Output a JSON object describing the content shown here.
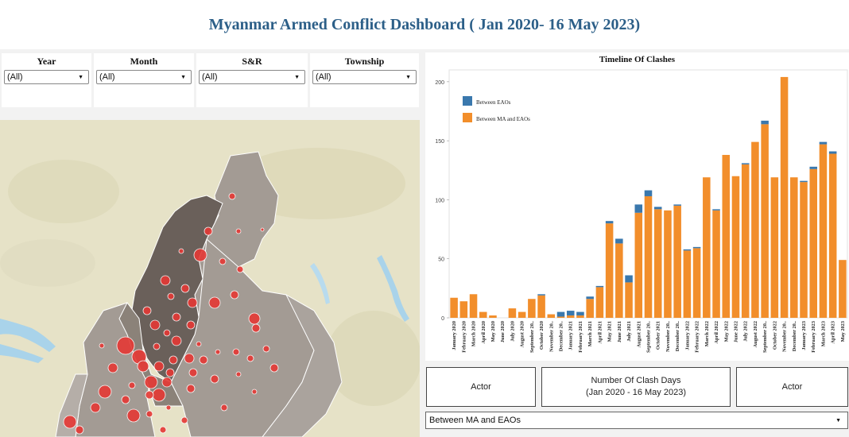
{
  "page_title": "Myanmar Armed Conflict Dashboard ( Jan 2020- 16 May 2023)",
  "filters": [
    {
      "label": "Year",
      "value": "(All)"
    },
    {
      "label": "Month",
      "value": "(All)"
    },
    {
      "label": "S&R",
      "value": "(All)"
    },
    {
      "label": "Township",
      "value": "(All)"
    }
  ],
  "timeline": {
    "title": "Timeline Of Clashes",
    "colors": {
      "Between EAOs": "#3a78ad",
      "Between MA and EAOs": "#f28e2b"
    }
  },
  "kpi": {
    "actor_left": "Actor",
    "clash_days_line1": "Number Of Clash Days",
    "clash_days_line2": "(Jan 2020 - 16 May 2023)",
    "actor_right": "Actor"
  },
  "actor_select": {
    "value": "Between MA and EAOs"
  },
  "chart_data": {
    "type": "bar",
    "stacked": true,
    "title": "Timeline Of Clashes",
    "ylim": [
      0,
      210
    ],
    "yticks": [
      0,
      50,
      100,
      150,
      200
    ],
    "legend_position": "top-left",
    "categories": [
      "January 2020",
      "February 2020",
      "March 2020",
      "April 2020",
      "May 2020",
      "June 2020",
      "July 2020",
      "August 2020",
      "September 20..",
      "October 2020",
      "November 20..",
      "December 20..",
      "January 2021",
      "February 2021",
      "March 2021",
      "April 2021",
      "May 2021",
      "June 2021",
      "July 2021",
      "August 2021",
      "September 20..",
      "October 2021",
      "November 20..",
      "December 20..",
      "January 2022",
      "February 2022",
      "March 2022",
      "April 2022",
      "May 2022",
      "June 2022",
      "July 2022",
      "August 2022",
      "September 20..",
      "October 2022",
      "November 20..",
      "December 20..",
      "January 2023",
      "February 2023",
      "March 2023",
      "April 2023",
      "May 2023"
    ],
    "series": [
      {
        "name": "Between EAOs",
        "values": [
          0,
          0,
          0,
          0,
          0,
          0,
          0,
          0,
          0,
          1,
          0,
          4,
          4,
          3,
          2,
          1,
          2,
          4,
          6,
          7,
          5,
          2,
          0,
          1,
          1,
          1,
          0,
          1,
          0,
          0,
          1,
          0,
          3,
          0,
          0,
          0,
          1,
          2,
          2,
          2,
          0
        ]
      },
      {
        "name": "Between MA and EAOs",
        "values": [
          17,
          14,
          20,
          5,
          2,
          0,
          8,
          5,
          16,
          19,
          3,
          1,
          2,
          2,
          16,
          26,
          80,
          63,
          30,
          89,
          103,
          92,
          91,
          95,
          57,
          59,
          119,
          91,
          138,
          120,
          130,
          149,
          164,
          119,
          204,
          119,
          115,
          126,
          147,
          139,
          49
        ]
      }
    ]
  },
  "map": {
    "marker_color": "#e53935",
    "region_color_dark": "#6a605a",
    "region_color": "#a39b94"
  }
}
